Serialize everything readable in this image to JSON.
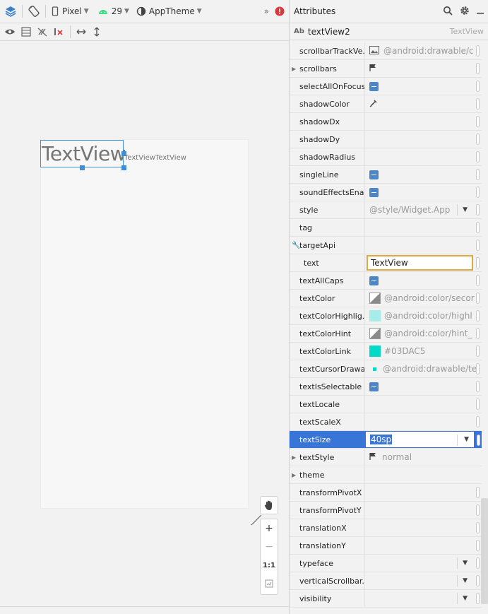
{
  "toolbar": {
    "device": "Pixel",
    "api": "29",
    "theme": "AppTheme"
  },
  "canvas": {
    "selected_text": "TextView",
    "sibling_text": "TextViewTextView"
  },
  "zoom": {
    "ratio": "1:1"
  },
  "attributes": {
    "title": "Attributes",
    "component_icon": "Ab",
    "component_id": "textView2",
    "component_type": "TextView",
    "rows": [
      {
        "name": "scrollbarTrackVe...",
        "value": "@android:drawable/c",
        "kind": "image"
      },
      {
        "name": "scrollbars",
        "value": "",
        "kind": "flag",
        "expandable": true
      },
      {
        "name": "selectAllOnFocus",
        "value": "",
        "kind": "check"
      },
      {
        "name": "shadowColor",
        "value": "",
        "kind": "picker"
      },
      {
        "name": "shadowDx",
        "value": "",
        "kind": "plain"
      },
      {
        "name": "shadowDy",
        "value": "",
        "kind": "plain"
      },
      {
        "name": "shadowRadius",
        "value": "",
        "kind": "plain"
      },
      {
        "name": "singleLine",
        "value": "",
        "kind": "check"
      },
      {
        "name": "soundEffectsEna...",
        "value": "",
        "kind": "check"
      },
      {
        "name": "style",
        "value": "@style/Widget.App",
        "kind": "dropdown"
      },
      {
        "name": "tag",
        "value": "",
        "kind": "plain"
      },
      {
        "name": "targetApi",
        "value": "",
        "kind": "wrench"
      },
      {
        "name": "text",
        "value": "TextView",
        "kind": "editing"
      },
      {
        "name": "textAllCaps",
        "value": "",
        "kind": "check"
      },
      {
        "name": "textColor",
        "value": "@android:color/secor",
        "kind": "swatch",
        "color": "#8a8a8a"
      },
      {
        "name": "textColorHighlig...",
        "value": "@android:color/highl",
        "kind": "swatch",
        "color": "#a6ece8"
      },
      {
        "name": "textColorHint",
        "value": "@android:color/hint_",
        "kind": "swatch",
        "color": "#8a8a8a"
      },
      {
        "name": "textColorLink",
        "value": "#03DAC5",
        "kind": "swatch",
        "color": "#03DAC5"
      },
      {
        "name": "textCursorDrawa...",
        "value": "@android:drawable/te",
        "kind": "dot",
        "color": "#03DAC5"
      },
      {
        "name": "textIsSelectable",
        "value": "",
        "kind": "check"
      },
      {
        "name": "textLocale",
        "value": "",
        "kind": "plain"
      },
      {
        "name": "textScaleX",
        "value": "",
        "kind": "plain"
      },
      {
        "name": "textSize",
        "value": "40sp",
        "kind": "selected"
      },
      {
        "name": "textStyle",
        "value": "normal",
        "kind": "flag",
        "expandable": true
      },
      {
        "name": "theme",
        "value": "",
        "kind": "none",
        "expandable": true
      },
      {
        "name": "transformPivotX",
        "value": "",
        "kind": "plain"
      },
      {
        "name": "transformPivotY",
        "value": "",
        "kind": "plain"
      },
      {
        "name": "translationX",
        "value": "",
        "kind": "plain"
      },
      {
        "name": "translationY",
        "value": "",
        "kind": "plain"
      },
      {
        "name": "typeface",
        "value": "",
        "kind": "dropdown"
      },
      {
        "name": "verticalScrollbar...",
        "value": "",
        "kind": "dropdown"
      },
      {
        "name": "visibility",
        "value": "",
        "kind": "dropdown"
      }
    ]
  }
}
